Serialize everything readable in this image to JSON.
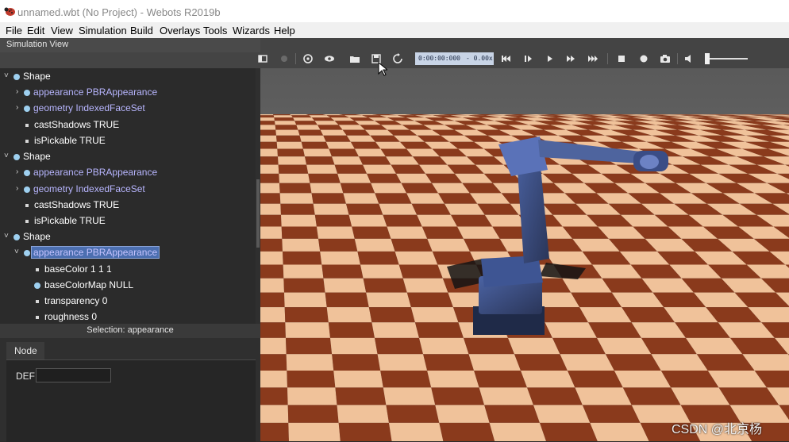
{
  "window": {
    "title": "unnamed.wbt (No Project) - Webots R2019b"
  },
  "menu": [
    "File",
    "Edit",
    "View",
    "Simulation",
    "Build",
    "Overlays",
    "Tools",
    "Wizards",
    "Help"
  ],
  "dock": {
    "title": "Simulation View"
  },
  "toolbar": {
    "time": "0:00:00:000",
    "speed": "-  0.00x",
    "icons": [
      "show-scene-tree-icon",
      "record-icon",
      "follow-icon",
      "view-icon",
      "open-icon",
      "save-icon",
      "reload-icon",
      "reset-icon",
      "step-icon",
      "play-icon",
      "fast-icon",
      "fastest-icon",
      "render-icon",
      "record-movie-icon",
      "screenshot-icon",
      "volume-icon"
    ]
  },
  "tree": [
    {
      "label": "Shape",
      "kind": "node",
      "arrow": "˅"
    },
    {
      "label": "appearance PBRAppearance",
      "kind": "field-node",
      "arrow": "›"
    },
    {
      "label": "geometry IndexedFaceSet",
      "kind": "field-node",
      "arrow": "›"
    },
    {
      "label": "castShadows TRUE",
      "kind": "value"
    },
    {
      "label": "isPickable TRUE",
      "kind": "value"
    },
    {
      "label": "Shape",
      "kind": "node",
      "arrow": "˅"
    },
    {
      "label": "appearance PBRAppearance",
      "kind": "field-node",
      "arrow": "›"
    },
    {
      "label": "geometry IndexedFaceSet",
      "kind": "field-node",
      "arrow": "›"
    },
    {
      "label": "castShadows TRUE",
      "kind": "value"
    },
    {
      "label": "isPickable TRUE",
      "kind": "value"
    },
    {
      "label": "Shape",
      "kind": "node",
      "arrow": "˅"
    },
    {
      "label": "appearance PBRAppearance",
      "kind": "field-node",
      "arrow": "˅",
      "selected": true
    },
    {
      "label": "baseColor 1 1 1",
      "kind": "value"
    },
    {
      "label": "baseColorMap NULL",
      "kind": "node-value"
    },
    {
      "label": "transparency 0",
      "kind": "value"
    },
    {
      "label": "roughness 0",
      "kind": "value"
    }
  ],
  "selection": "Selection: appearance",
  "node_panel": {
    "tab": "Node",
    "def_label": "DEF:",
    "def_value": ""
  },
  "watermark": "CSDN @北京杨",
  "colors": {
    "checker_light": "#f0c29a",
    "checker_dark": "#8a3a1c",
    "robot": "#3b4e82",
    "selection": "#4c6fb0"
  }
}
